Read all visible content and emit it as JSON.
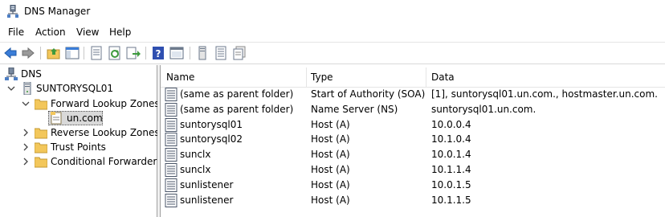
{
  "window": {
    "title": "DNS Manager"
  },
  "menu": [
    "File",
    "Action",
    "View",
    "Help"
  ],
  "toolbar": {
    "buttons": [
      "back-icon",
      "forward-icon",
      "up-folder-icon",
      "show-hide-tree-icon",
      "properties-icon",
      "refresh-icon",
      "export-list-icon",
      "help-icon",
      "console-icon",
      "server-icon",
      "records-icon",
      "zone-icon"
    ]
  },
  "tree": {
    "root": "DNS",
    "server": "SUNTORYSQL01",
    "forward_zones": "Forward Lookup Zones",
    "zone": "un.com",
    "reverse_zones": "Reverse Lookup Zones",
    "trust_points": "Trust Points",
    "conditional_forwarders": "Conditional Forwarders"
  },
  "table": {
    "columns": [
      "Name",
      "Type",
      "Data"
    ],
    "rows": [
      {
        "name": "(same as parent folder)",
        "type": "Start of Authority (SOA)",
        "data": "[1], suntorysql01.un.com., hostmaster.un.com."
      },
      {
        "name": "(same as parent folder)",
        "type": "Name Server (NS)",
        "data": "suntorysql01.un.com."
      },
      {
        "name": "suntorysql01",
        "type": "Host (A)",
        "data": "10.0.0.4"
      },
      {
        "name": "suntorysql02",
        "type": "Host (A)",
        "data": "10.1.0.4"
      },
      {
        "name": "sunclx",
        "type": "Host (A)",
        "data": "10.0.1.4"
      },
      {
        "name": "sunclx",
        "type": "Host (A)",
        "data": "10.1.1.4"
      },
      {
        "name": "sunlistener",
        "type": "Host (A)",
        "data": "10.0.1.5"
      },
      {
        "name": "sunlistener",
        "type": "Host (A)",
        "data": "10.1.1.5"
      }
    ]
  },
  "colors": {
    "selection": "#d9d9d9",
    "folder": "#f3c75b",
    "arrow": "#3a7dd8"
  }
}
